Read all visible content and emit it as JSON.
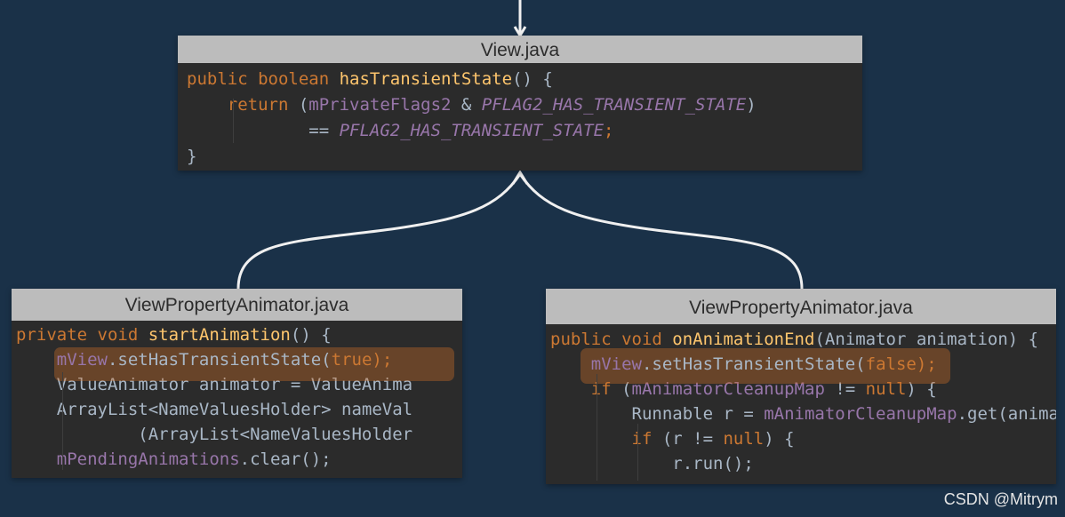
{
  "view_window": {
    "title": "View.java",
    "line1": {
      "t1": "public boolean ",
      "t2": "hasTransientState",
      "t3": "() {"
    },
    "line2": {
      "t1": "    ",
      "t2": "return",
      "t3": " (",
      "t4": "mPrivateFlags2",
      "t5": " & ",
      "t6": "PFLAG2_HAS_TRANSIENT_STATE",
      "t7": ")"
    },
    "line3": {
      "t1": "            == ",
      "t2": "PFLAG2_HAS_TRANSIENT_STATE",
      "t3": ";"
    },
    "line4": {
      "t1": "}"
    }
  },
  "start_window": {
    "title": "ViewPropertyAnimator.java",
    "line1": {
      "t1": "private void ",
      "t2": "startAnimation",
      "t3": "() {"
    },
    "line2": {
      "t1": "    ",
      "t2": "mView",
      "t3": ".setHasTransientState(",
      "t4": "true",
      "t5": ");"
    },
    "line3": {
      "t1": "    ValueAnimator animator = ValueAnima"
    },
    "line4": {
      "t1": "    ArrayList<NameValuesHolder> nameVal"
    },
    "line5": {
      "t1": "            (ArrayList<NameValuesHolder"
    },
    "line6": {
      "t1": "    ",
      "t2": "mPendingAnimations",
      "t3": ".clear();"
    }
  },
  "end_window": {
    "title": "ViewPropertyAnimator.java",
    "line1": {
      "t1": "public void ",
      "t2": "onAnimationEnd",
      "t3": "(Animator animation) {"
    },
    "line2": {
      "t1": "    ",
      "t2": "mView",
      "t3": ".setHasTransientState(",
      "t4": "false",
      "t5": ");"
    },
    "line3": {
      "t1": "    ",
      "t2": "if",
      "t3": " (",
      "t4": "mAnimatorCleanupMap",
      "t5": " != ",
      "t6": "null",
      "t7": ") {"
    },
    "line4": {
      "t1": "        Runnable r = ",
      "t2": "mAnimatorCleanupMap",
      "t3": ".get(anima"
    },
    "line5": {
      "t1": "        ",
      "t2": "if",
      "t3": " (r != ",
      "t4": "null",
      "t5": ") {"
    },
    "line6": {
      "t1": "            r.run();"
    }
  },
  "watermark": "CSDN @Mitrym",
  "colors": {
    "background": "#1a3148",
    "editor": "#2b2b2b",
    "title_bar": "#bcbcbc",
    "keyword": "#cc7832",
    "method": "#ffc66d",
    "field": "#9876aa",
    "highlight": "#cc6e28"
  }
}
